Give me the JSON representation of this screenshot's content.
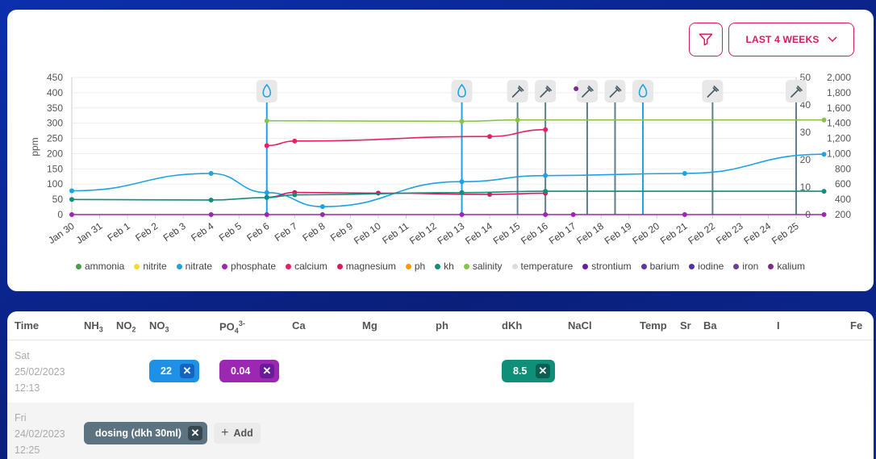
{
  "controls": {
    "filter_icon": "filter-icon",
    "range_label": "LAST 4 WEEKS"
  },
  "chart_data": {
    "type": "line",
    "y_left_label": "ppm",
    "y_left_ticks": [
      "450",
      "400",
      "350",
      "300",
      "250",
      "200",
      "150",
      "100",
      "50",
      "0"
    ],
    "y_left_range": [
      0,
      450
    ],
    "y_mid_ticks": [
      "50",
      "40",
      "30",
      "20",
      "10",
      "0"
    ],
    "y_mid_range": [
      0,
      50
    ],
    "y_right_ticks": [
      "2,000",
      "1,800",
      "1,600",
      "1,400",
      "1,200",
      "1,000",
      "800",
      "600",
      "400",
      "200"
    ],
    "y_right_range": [
      200,
      2000
    ],
    "x_labels": [
      "Jan 30",
      "Jan 31",
      "Feb 1",
      "Feb 2",
      "Feb 3",
      "Feb 4",
      "Feb 5",
      "Feb 6",
      "Feb 7",
      "Feb 8",
      "Feb 9",
      "Feb 10",
      "Feb 11",
      "Feb 12",
      "Feb 13",
      "Feb 14",
      "Feb 15",
      "Feb 16",
      "Feb 17",
      "Feb 18",
      "Feb 19",
      "Feb 20",
      "Feb 21",
      "Feb 22",
      "Feb 23",
      "Feb 24",
      "Feb 25"
    ],
    "grid": true,
    "series": [
      {
        "name": "nitrate",
        "color": "#1fa2e3",
        "axis": "left",
        "points": [
          [
            0,
            78
          ],
          [
            5,
            135
          ],
          [
            7,
            72
          ],
          [
            9,
            26
          ],
          [
            14,
            108
          ],
          [
            17,
            128
          ],
          [
            22,
            135
          ],
          [
            27,
            198
          ]
        ]
      },
      {
        "name": "calcium",
        "color": "#e91e63",
        "axis": "right",
        "points": [
          [
            7,
            1105
          ],
          [
            8,
            1165
          ],
          [
            15,
            1225
          ],
          [
            17,
            1315
          ]
        ]
      },
      {
        "name": "magnesium",
        "color": "#d81b60",
        "axis": "right",
        "points": [
          [
            7,
            427
          ],
          [
            8,
            490
          ],
          [
            11,
            482
          ],
          [
            15,
            465
          ],
          [
            17,
            480
          ]
        ]
      },
      {
        "name": "kh",
        "color": "#0f8f7a",
        "axis": "mid",
        "points": [
          [
            0,
            5.5
          ],
          [
            5,
            5.3
          ],
          [
            7,
            6.2
          ],
          [
            8,
            7.2
          ],
          [
            14,
            8.0
          ],
          [
            17,
            8.5
          ],
          [
            27,
            8.5
          ]
        ]
      },
      {
        "name": "salinity",
        "color": "#8bc34a",
        "axis": "mid",
        "points": [
          [
            7,
            34.2
          ],
          [
            14,
            34.0
          ],
          [
            16,
            34.5
          ],
          [
            27,
            34.5
          ]
        ]
      },
      {
        "name": "phosphate",
        "color": "#9c27b0",
        "axis": "left",
        "points": [
          [
            0,
            0
          ],
          [
            5,
            0
          ],
          [
            7,
            0
          ],
          [
            9,
            0
          ],
          [
            14,
            0
          ],
          [
            17,
            0
          ],
          [
            18,
            0
          ],
          [
            22,
            0
          ],
          [
            27,
            0
          ]
        ]
      }
    ],
    "markers": [
      {
        "day": 7,
        "kind": "water-drop-icon"
      },
      {
        "day": 14,
        "kind": "water-drop-icon"
      },
      {
        "day": 16,
        "kind": "dropper-icon"
      },
      {
        "day": 17,
        "kind": "dropper-icon"
      },
      {
        "day": 18.5,
        "kind": "dropper-icon"
      },
      {
        "day": 19.5,
        "kind": "dropper-icon"
      },
      {
        "day": 20.5,
        "kind": "water-drop-icon"
      },
      {
        "day": 23,
        "kind": "dropper-icon"
      },
      {
        "day": 26,
        "kind": "dropper-icon"
      }
    ]
  },
  "legend": [
    {
      "label": "ammonia",
      "color": "#43a047"
    },
    {
      "label": "nitrite",
      "color": "#fdd835"
    },
    {
      "label": "nitrate",
      "color": "#1fa2e3"
    },
    {
      "label": "phosphate",
      "color": "#9c27b0"
    },
    {
      "label": "calcium",
      "color": "#e91e63"
    },
    {
      "label": "magnesium",
      "color": "#d81b60"
    },
    {
      "label": "ph",
      "color": "#ff9800"
    },
    {
      "label": "kh",
      "color": "#0f8f7a"
    },
    {
      "label": "salinity",
      "color": "#8bc34a"
    },
    {
      "label": "temperature",
      "color": "#dddddd"
    },
    {
      "label": "strontium",
      "color": "#6a1b9a"
    },
    {
      "label": "barium",
      "color": "#5e35b1"
    },
    {
      "label": "iodine",
      "color": "#512da8"
    },
    {
      "label": "iron",
      "color": "#6a3d9a"
    },
    {
      "label": "kalium",
      "color": "#7b2d8e"
    }
  ],
  "table": {
    "headers": {
      "time": "Time",
      "nh3": "NH",
      "nh3_sub": "3",
      "no2": "NO",
      "no2_sub": "2",
      "no3": "NO",
      "no3_sub": "3",
      "po4": "PO",
      "po4_sub": "4",
      "po4_sup": "3-",
      "ca": "Ca",
      "mg": "Mg",
      "ph": "ph",
      "dkh": "dKh",
      "nacl": "NaCl",
      "temp": "Temp",
      "sr": "Sr",
      "ba": "Ba",
      "i": "I",
      "fe": "Fe"
    },
    "rows": [
      {
        "day": "Sat",
        "date": "25/02/2023",
        "time": "12:13",
        "no3": "22",
        "po4": "0.04",
        "dkh": "8.5"
      },
      {
        "day": "Fri",
        "date": "24/02/2023",
        "time": "12:25",
        "event": "dosing (dkh 30ml)",
        "add_label": "Add"
      }
    ],
    "colors": {
      "no3": "#1e90e6",
      "po4": "#9c27b0",
      "dkh": "#0f8f7a",
      "event": "#5d7380"
    }
  }
}
